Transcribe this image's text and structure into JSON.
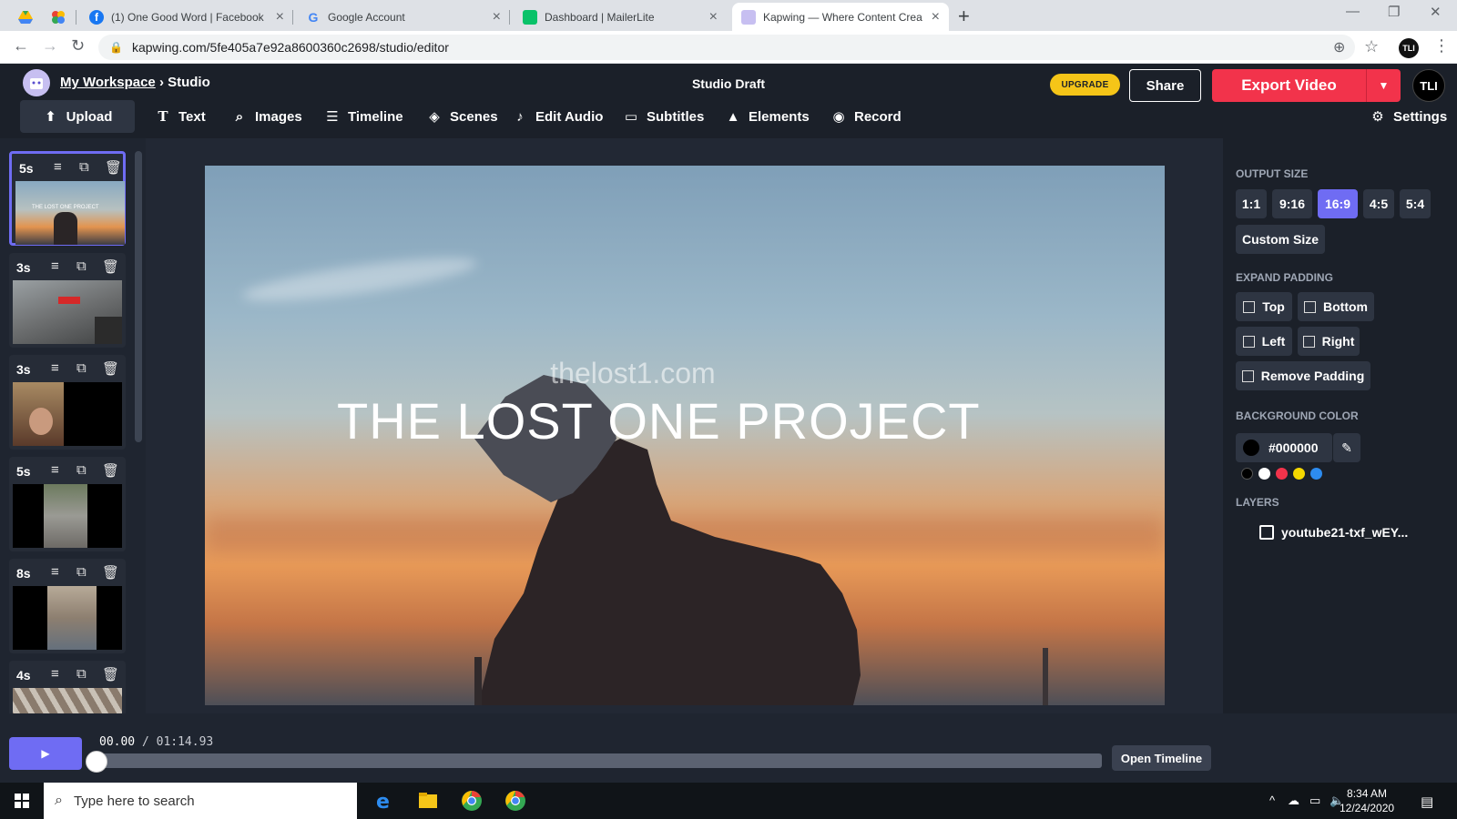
{
  "browser": {
    "tabs": [
      {
        "title": ""
      },
      {
        "title": ""
      },
      {
        "title": "(1) One Good Word | Facebook"
      },
      {
        "title": "Google Account"
      },
      {
        "title": "Dashboard | MailerLite"
      },
      {
        "title": "Kapwing — Where Content Crea"
      }
    ],
    "new_tab_label": "+",
    "url": "kapwing.com/5fe405a7e92a8600360c2698/studio/editor",
    "profile_initials": "TLI"
  },
  "app": {
    "breadcrumb_workspace": "My Workspace",
    "breadcrumb_sep": "›",
    "breadcrumb_page": "Studio",
    "draft_title": "Studio Draft",
    "upgrade_label": "UPGRADE",
    "share_label": "Share",
    "export_label": "Export Video",
    "user_initials": "TLI",
    "toolbar": [
      {
        "label": "Upload",
        "icon": "upload-icon"
      },
      {
        "label": "Text",
        "icon": "text-icon"
      },
      {
        "label": "Images",
        "icon": "search-icon"
      },
      {
        "label": "Timeline",
        "icon": "timeline-icon"
      },
      {
        "label": "Scenes",
        "icon": "layers-icon"
      },
      {
        "label": "Edit Audio",
        "icon": "music-note-icon"
      },
      {
        "label": "Subtitles",
        "icon": "subtitles-icon"
      },
      {
        "label": "Elements",
        "icon": "shapes-icon"
      },
      {
        "label": "Record",
        "icon": "record-icon"
      }
    ],
    "settings_label": "Settings"
  },
  "scenes": [
    {
      "duration": "5s"
    },
    {
      "duration": "3s"
    },
    {
      "duration": "3s"
    },
    {
      "duration": "5s"
    },
    {
      "duration": "8s"
    },
    {
      "duration": "4s"
    }
  ],
  "scene_thumb_text": "THE LOST ONE PROJECT",
  "canvas": {
    "watermark": "thelost1.com",
    "headline": "THE LOST ONE PROJECT"
  },
  "panel": {
    "output_size_label": "OUTPUT SIZE",
    "sizes": [
      "1:1",
      "9:16",
      "16:9",
      "4:5",
      "5:4"
    ],
    "selected_size": "16:9",
    "custom_size_label": "Custom Size",
    "expand_padding_label": "EXPAND PADDING",
    "padding": {
      "top": "Top",
      "bottom": "Bottom",
      "left": "Left",
      "right": "Right",
      "remove": "Remove Padding"
    },
    "background_color_label": "BACKGROUND COLOR",
    "background_color": "#000000",
    "swatches": [
      "#000000",
      "#ffffff",
      "#f2334b",
      "#f5d800",
      "#2d8cf0"
    ],
    "layers_label": "LAYERS",
    "layer_name": "youtube21-txf_wEY..."
  },
  "playback": {
    "current_time": "00.00",
    "separator": "/",
    "total_time": "01:14.93",
    "open_timeline_label": "Open Timeline"
  },
  "taskbar": {
    "search_placeholder": "Type here to search",
    "time": "8:34 AM",
    "date": "12/24/2020"
  },
  "colors": {
    "accent": "#6f6cf3",
    "export": "#f2334b",
    "upgrade": "#f5c518"
  }
}
